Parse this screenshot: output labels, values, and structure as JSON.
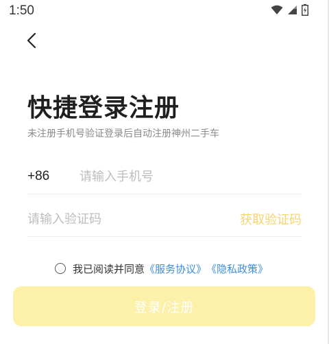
{
  "status_bar": {
    "time": "1:50"
  },
  "header": {
    "back_icon": "chevron-left-icon"
  },
  "login": {
    "title": "快捷登录注册",
    "subtitle": "未注册手机号验证登录后自动注册神州二手车",
    "country_code": "+86",
    "phone_placeholder": "请输入手机号",
    "code_placeholder": "请输入验证码",
    "get_code_label": "获取验证码",
    "agree_prefix": "我已阅读并同意",
    "service_link": "《服务协议》",
    "privacy_link": "《隐私政策》",
    "submit_label": "登录/注册"
  },
  "colors": {
    "accent_disabled": "#fdf0a8",
    "get_code": "#f7d56e",
    "link": "#3d8ee0"
  }
}
